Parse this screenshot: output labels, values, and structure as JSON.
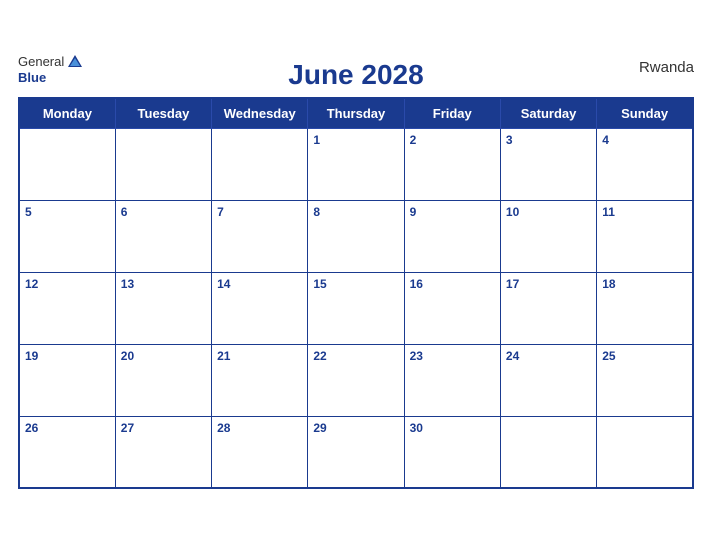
{
  "header": {
    "title": "June 2028",
    "country": "Rwanda",
    "logo_general": "General",
    "logo_blue": "Blue"
  },
  "weekdays": [
    "Monday",
    "Tuesday",
    "Wednesday",
    "Thursday",
    "Friday",
    "Saturday",
    "Sunday"
  ],
  "weeks": [
    [
      "",
      "",
      "",
      "1",
      "2",
      "3",
      "4"
    ],
    [
      "5",
      "6",
      "7",
      "8",
      "9",
      "10",
      "11"
    ],
    [
      "12",
      "13",
      "14",
      "15",
      "16",
      "17",
      "18"
    ],
    [
      "19",
      "20",
      "21",
      "22",
      "23",
      "24",
      "25"
    ],
    [
      "26",
      "27",
      "28",
      "29",
      "30",
      "",
      ""
    ]
  ]
}
